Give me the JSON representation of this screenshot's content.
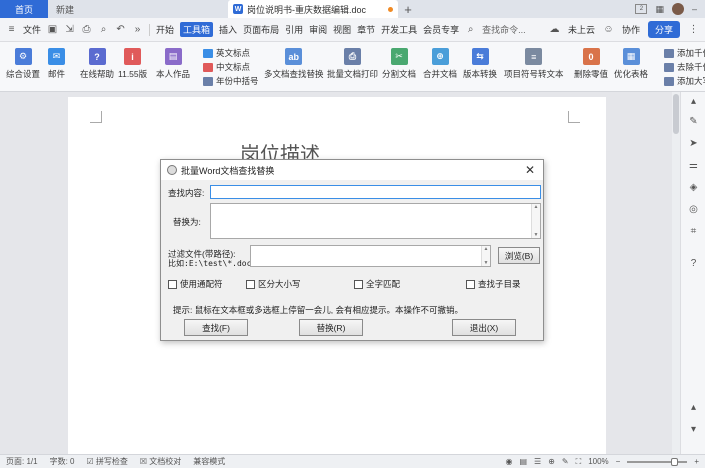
{
  "tabs": {
    "home": "首页",
    "new": "新建",
    "doc_name": "岗位说明书-重庆数据编辑.doc",
    "plus": "+",
    "badge": "2"
  },
  "menu": {
    "file": "文件",
    "items": [
      "开始",
      "工具箱",
      "插入",
      "页面布局",
      "引用",
      "审阅",
      "视图",
      "章节",
      "开发工具",
      "会员专享"
    ],
    "active_index": 1,
    "search": "查找命令...",
    "cloud": "未上云",
    "collab": "协作",
    "share": "分享"
  },
  "ribbon": {
    "buttons": [
      {
        "label": "综合设置",
        "color": "#4a7cd9",
        "glyph": "⚙"
      },
      {
        "label": "邮件",
        "color": "#3a8ee6",
        "glyph": "✉"
      },
      {
        "label": "在线帮助",
        "color": "#5b6bd0",
        "glyph": "?"
      },
      {
        "label": "11.55版",
        "color": "#e05a5a",
        "glyph": "i"
      },
      {
        "label": "本人作品",
        "color": "#8a6bc9",
        "glyph": "▤"
      },
      {
        "label": "多文档查找替换",
        "color": "#5a8fd9",
        "glyph": "ab"
      },
      {
        "label": "批量文档打印",
        "color": "#6a7fa8",
        "glyph": "⎙"
      },
      {
        "label": "分割文档",
        "color": "#4aa870",
        "glyph": "✂"
      },
      {
        "label": "合并文档",
        "color": "#4a9ed9",
        "glyph": "⊕"
      },
      {
        "label": "版本转换",
        "color": "#4a7cd9",
        "glyph": "⇆"
      },
      {
        "label": "项目符号转文本",
        "color": "#7b8aa0",
        "glyph": "≡"
      },
      {
        "label": "删除零值",
        "color": "#d9734a",
        "glyph": "0"
      },
      {
        "label": "优化表格",
        "color": "#5a8fd9",
        "glyph": "▦"
      }
    ],
    "small": [
      {
        "label": "英文标点",
        "color": "#3a8ee6"
      },
      {
        "label": "中文标点",
        "color": "#e05a5a"
      },
      {
        "label": "年份中括号",
        "color": "#6a7fa8"
      }
    ],
    "right_small": [
      "添加千位",
      "去除千位",
      "添加大写"
    ]
  },
  "document": {
    "title": "岗位描述"
  },
  "dialog": {
    "title": "批量Word文档查找替换",
    "find_label": "查找内容:",
    "replace_label": "替换为:",
    "filter_label1": "过滤文件(带路径):",
    "filter_label2": "比如:E:\\test\\*.doc*",
    "browse": "浏览(B)",
    "checkboxes": [
      "使用通配符",
      "区分大小写",
      "全字匹配",
      "查找子目录"
    ],
    "hint": "提示: 鼠标在文本框或多选框上停留一会儿, 会有相应提示。本操作不可撤销。",
    "find_btn": "查找(F)",
    "replace_btn": "替换(R)",
    "exit_btn": "退出(X)"
  },
  "status": {
    "page": "页面: 1/1",
    "words": "字数: 0",
    "spell": "拼写检查",
    "proof": "文档校对",
    "compat": "兼容模式",
    "zoom": "100%"
  }
}
